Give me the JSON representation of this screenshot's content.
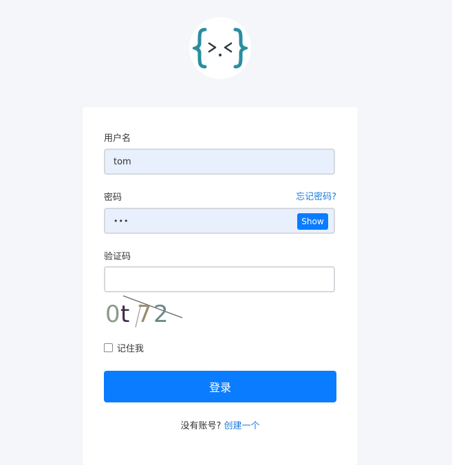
{
  "logo": {
    "icon": "code-brackets-logo"
  },
  "form": {
    "username": {
      "label": "用户名",
      "value": "tom"
    },
    "password": {
      "label": "密码",
      "value": "•••",
      "show_label": "Show",
      "forgot_link": "忘记密码?"
    },
    "captcha": {
      "label": "验证码",
      "value": "",
      "image_text": "0t72"
    },
    "remember_label": "记住我",
    "submit_label": "登录",
    "signup": {
      "prompt": "没有账号?",
      "link": "创建一个"
    }
  },
  "colors": {
    "accent": "#0a7cff",
    "link": "#1a7bd8",
    "input_filled_bg": "#e8f0fe",
    "logo_teal": "#2a8ea0"
  }
}
